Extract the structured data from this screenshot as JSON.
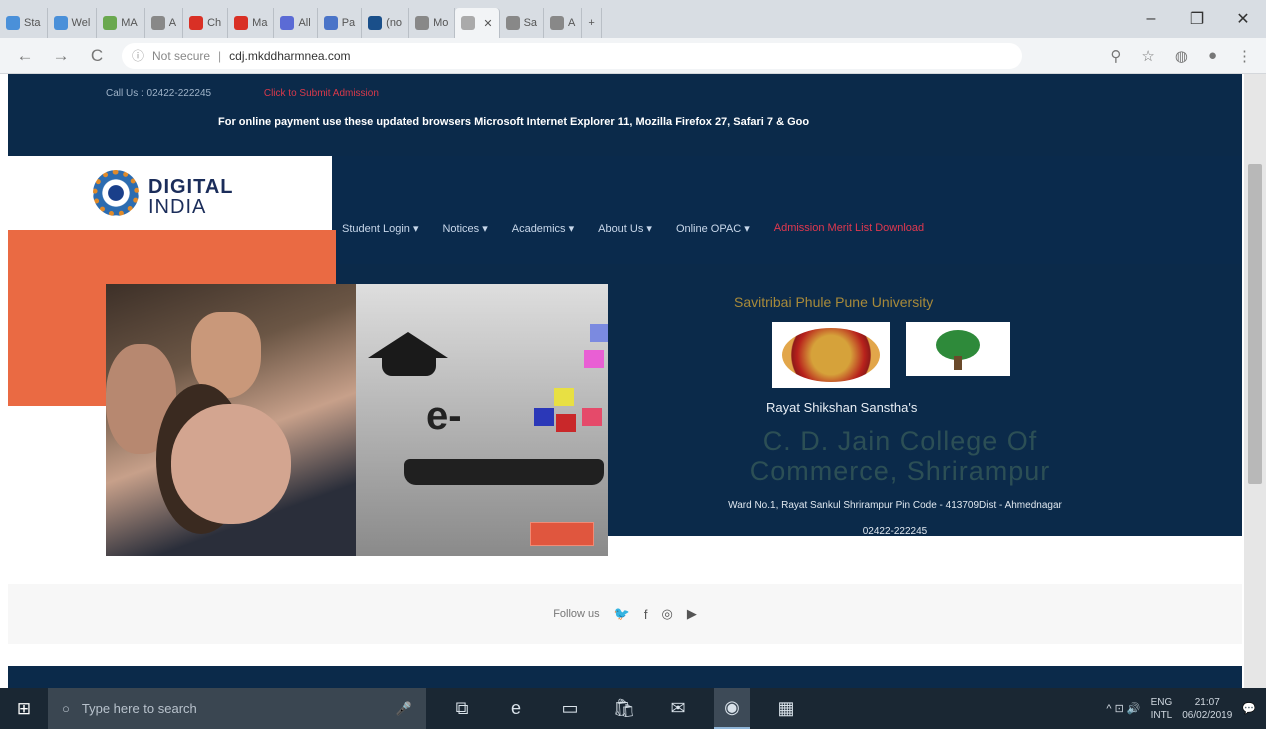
{
  "browser": {
    "tabs": [
      {
        "label": "Sta",
        "color": "#4a90d9"
      },
      {
        "label": "Wel",
        "color": "#4a90d9"
      },
      {
        "label": "MA",
        "color": "#6aa84f"
      },
      {
        "label": "A",
        "color": "#888888"
      },
      {
        "label": "Ch",
        "color": "#d93025"
      },
      {
        "label": "Ma",
        "color": "#d93025"
      },
      {
        "label": "All",
        "color": "#5b6bd5"
      },
      {
        "label": "Pa",
        "color": "#4a74c8"
      },
      {
        "label": "(no",
        "color": "#1a4f8a"
      },
      {
        "label": "Mo",
        "color": "#888888"
      },
      {
        "label": "",
        "color": "#aaaaaa"
      },
      {
        "label": "Sa",
        "color": "#888888"
      },
      {
        "label": "A",
        "color": "#888888"
      }
    ],
    "active_tab_index": 10,
    "new_tab": "+",
    "window": {
      "minimize": "–",
      "maximize": "❐",
      "close": "✕"
    },
    "back": "←",
    "forward": "→",
    "reload": "C",
    "security": "Not secure",
    "url": "cdj.mkddharmnea.com",
    "toolbar_icons": [
      "⚲",
      "☆",
      "◍",
      "●",
      "⋮"
    ]
  },
  "site": {
    "top_contact": "Call Us : 02422-222245",
    "top_red": "Click to Submit Admission",
    "notice": "For online payment use these updated browsers Microsoft Internet Explorer 11, Mozilla Firefox 27, Safari 7 & Goo",
    "logo_line1": "DIGITAL",
    "logo_line2": "INDIA",
    "menu": [
      "Student Login ▾",
      "Notices ▾",
      "Academics ▾",
      "About Us ▾",
      "Online OPAC ▾"
    ],
    "menu_red": "Admission Merit List Download",
    "university": "Savitribai Phule Pune University",
    "society": "Rayat Shikshan Sanstha's",
    "college": "C. D. Jain College Of Commerce, Shrirampur",
    "address": "Ward No.1, Rayat Sankul Shrirampur Pin Code - 413709Dist - Ahmednagar",
    "phone": "02422-222245",
    "hero_text": "e-",
    "follow_label": "Follow us",
    "social": [
      "🐦",
      "f",
      "◎",
      "▶"
    ]
  },
  "taskbar": {
    "start": "⊞",
    "search_placeholder": "Type here to search",
    "mic": "🎤",
    "apps": [
      "⧉",
      "e",
      "▭",
      "🛍",
      "✉",
      "◉",
      "▦"
    ],
    "active_app_index": 5,
    "tray_icons": "^ ⊡ 🔊",
    "lang_line1": "ENG",
    "lang_line2": "INTL",
    "time": "21:07",
    "date": "06/02/2019",
    "notifications": "💬"
  }
}
